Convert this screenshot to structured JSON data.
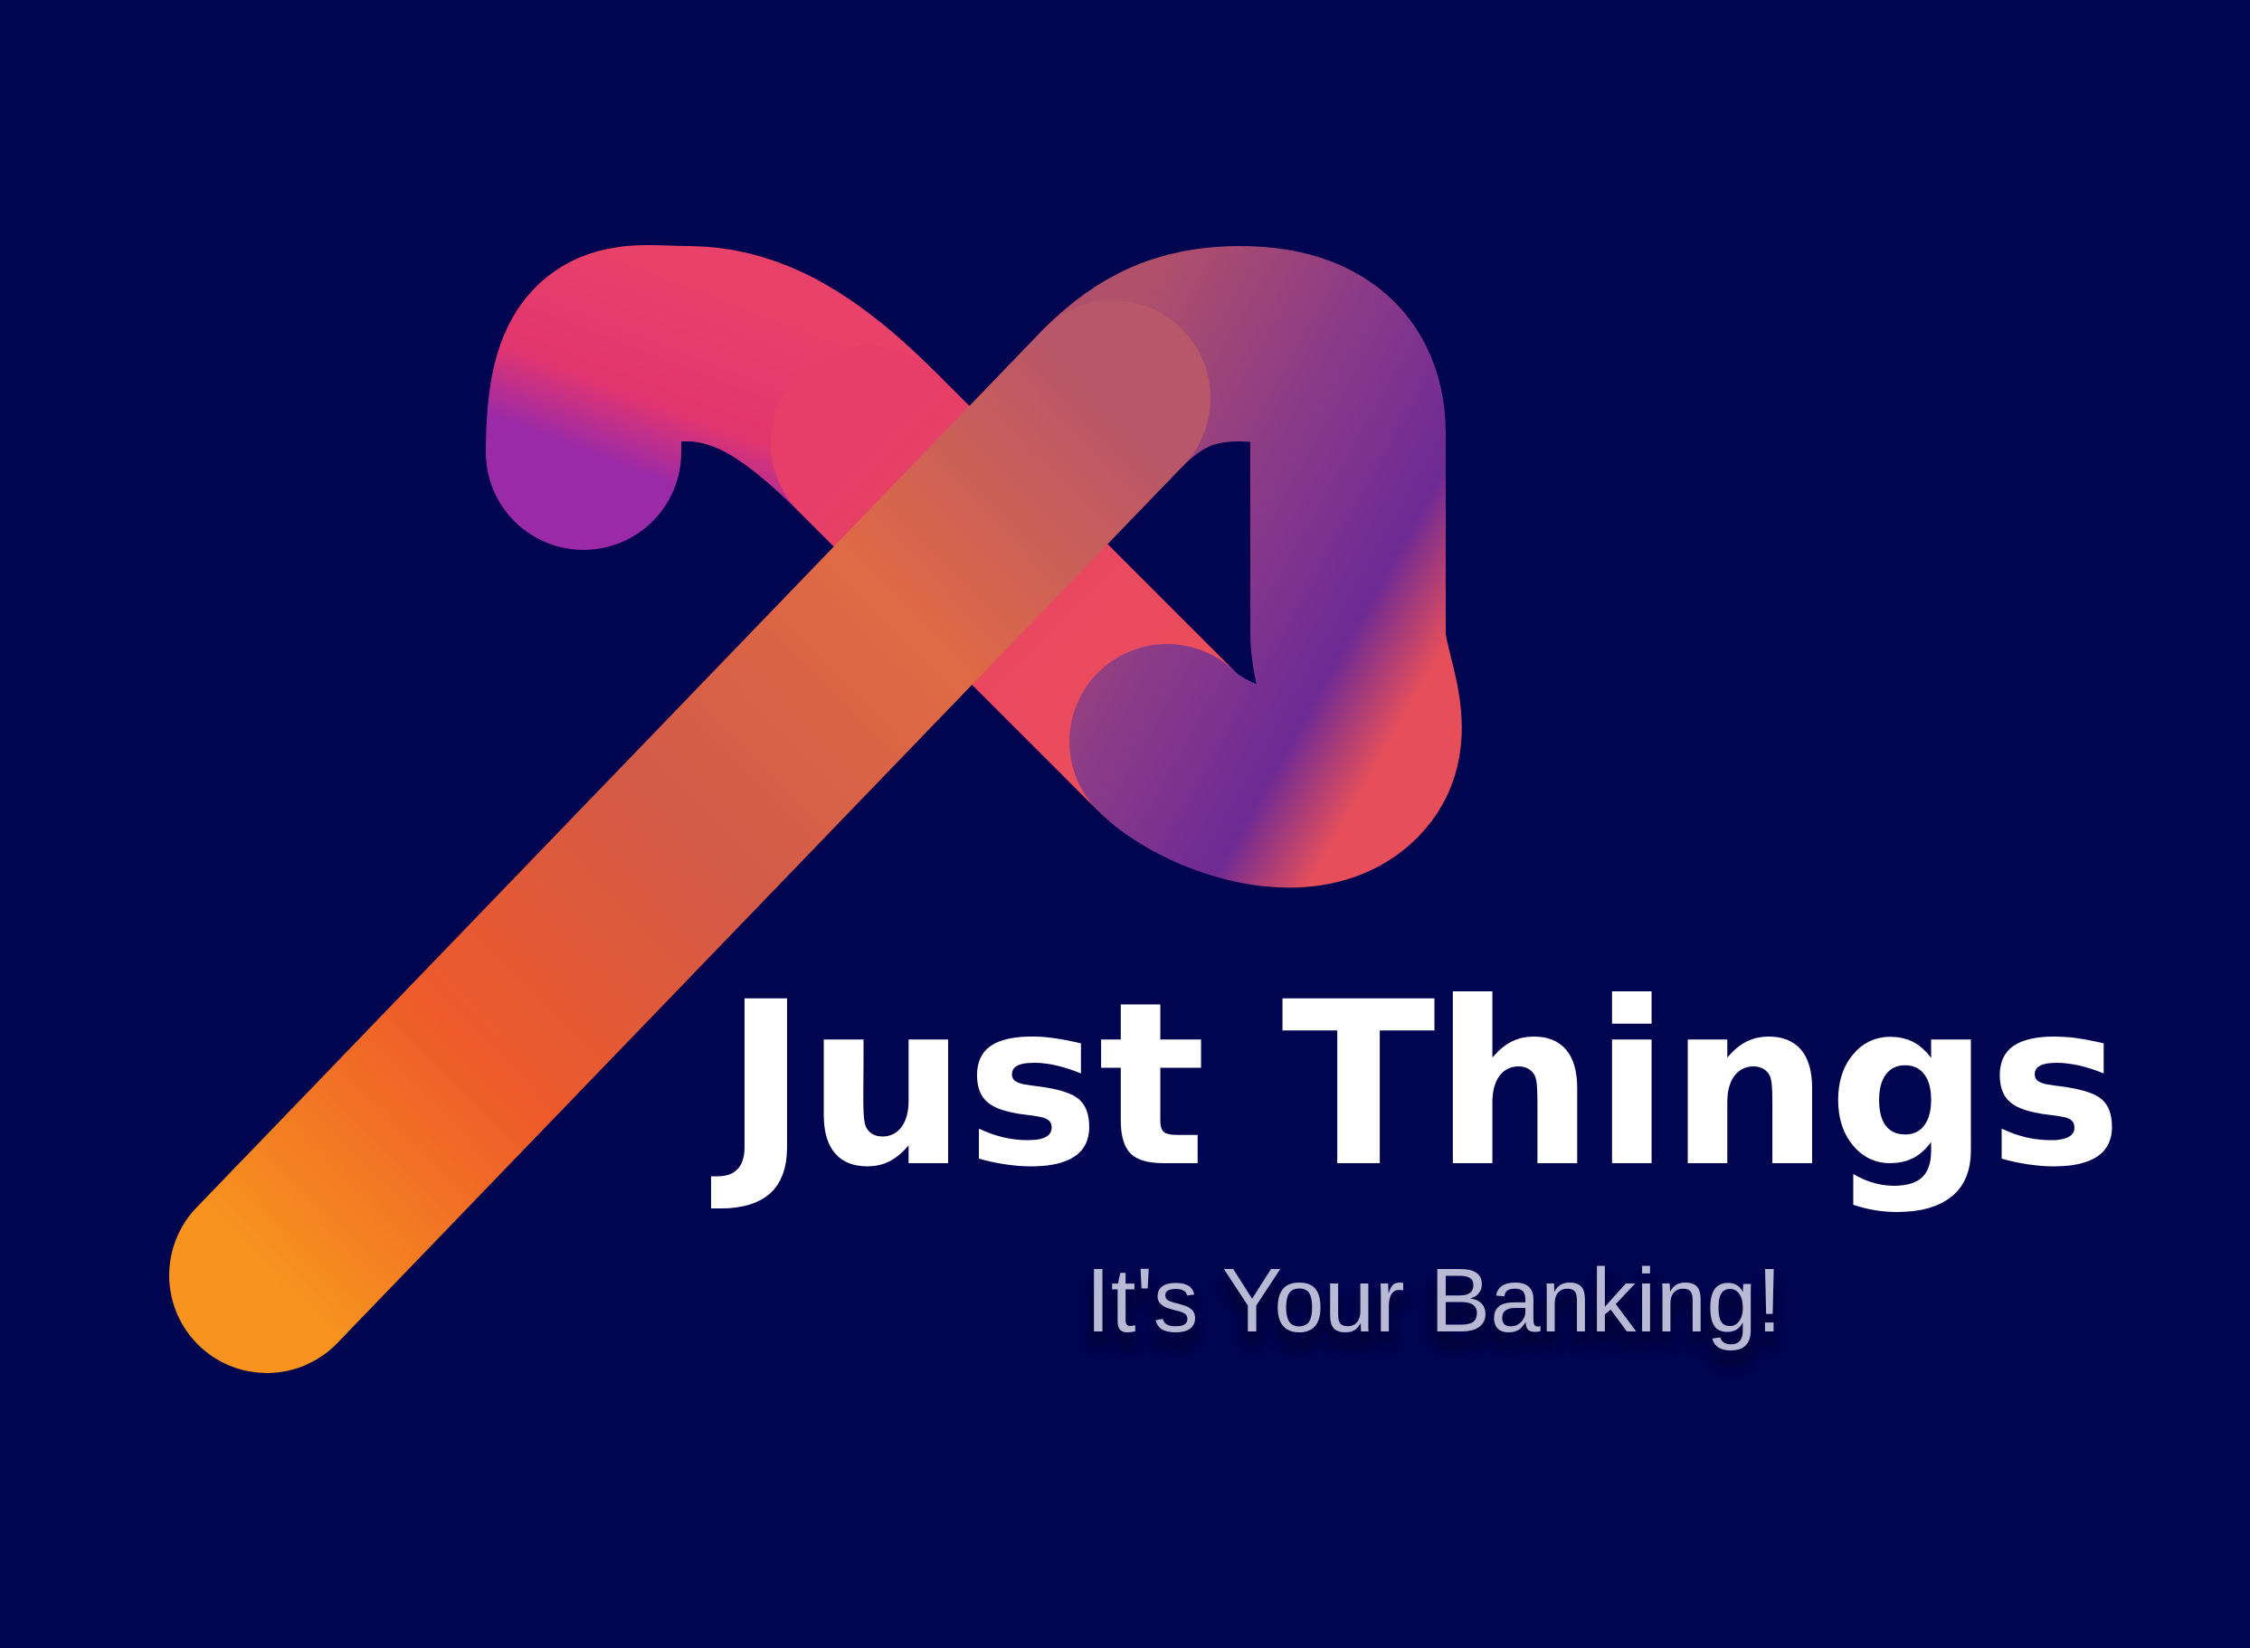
{
  "logo": {
    "name": "Just Things",
    "tagline": "It's Your Banking!",
    "icon": "infinity-ribbon-icon"
  },
  "colors": {
    "background": "#01044e",
    "brand_text": "#ffffff",
    "tagline_text": "#b8b9d4",
    "gradient_orange": "#f7931e",
    "gradient_red": "#ea4c5c",
    "gradient_pink": "#e53a70",
    "gradient_purple": "#7c2c93",
    "gradient_blue": "#1e0ae6"
  }
}
